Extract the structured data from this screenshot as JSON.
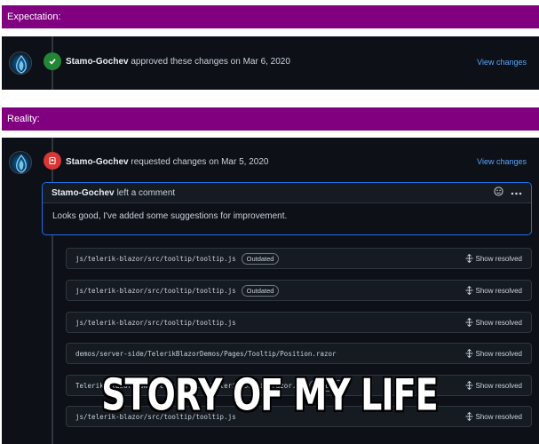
{
  "expectation": {
    "banner": "Expectation:",
    "event": {
      "author": "Stamo-Gochev",
      "action": "approved these changes on Mar 6, 2020",
      "link": "View changes"
    }
  },
  "reality": {
    "banner": "Reality:",
    "event": {
      "author": "Stamo-Gochev",
      "action": "requested changes on Mar 5, 2020",
      "link": "View changes"
    },
    "comment": {
      "author": "Stamo-Gochev",
      "header_suffix": "left a comment",
      "body": "Looks good, I've added some suggestions for improvement."
    },
    "files": [
      {
        "path": "js/telerik-blazor/src/tooltip/tooltip.js",
        "badge": "Outdated",
        "action": "Show resolved"
      },
      {
        "path": "js/telerik-blazor/src/tooltip/tooltip.js",
        "badge": "Outdated",
        "action": "Show resolved"
      },
      {
        "path": "js/telerik-blazor/src/tooltip/tooltip.js",
        "badge": "",
        "action": "Show resolved"
      },
      {
        "path": "demos/server-side/TelerikBlazorDemos/Pages/Tooltip/Position.razor",
        "badge": "",
        "action": "Show resolved"
      },
      {
        "path": "Telerik.Blazor/Components/Tooltip/TelerikTooltip.razor.cs",
        "badge": "Outdated",
        "action": "Show resolved"
      },
      {
        "path": "js/telerik-blazor/src/tooltip/tooltip.js",
        "badge": "",
        "action": "Show resolved"
      }
    ]
  },
  "meme_caption": "STORY OF MY LIFE",
  "colors": {
    "banner": "#800080",
    "panel": "#0d1117",
    "link": "#58a6ff",
    "approved": "#238636",
    "changes_requested": "#da3633"
  }
}
